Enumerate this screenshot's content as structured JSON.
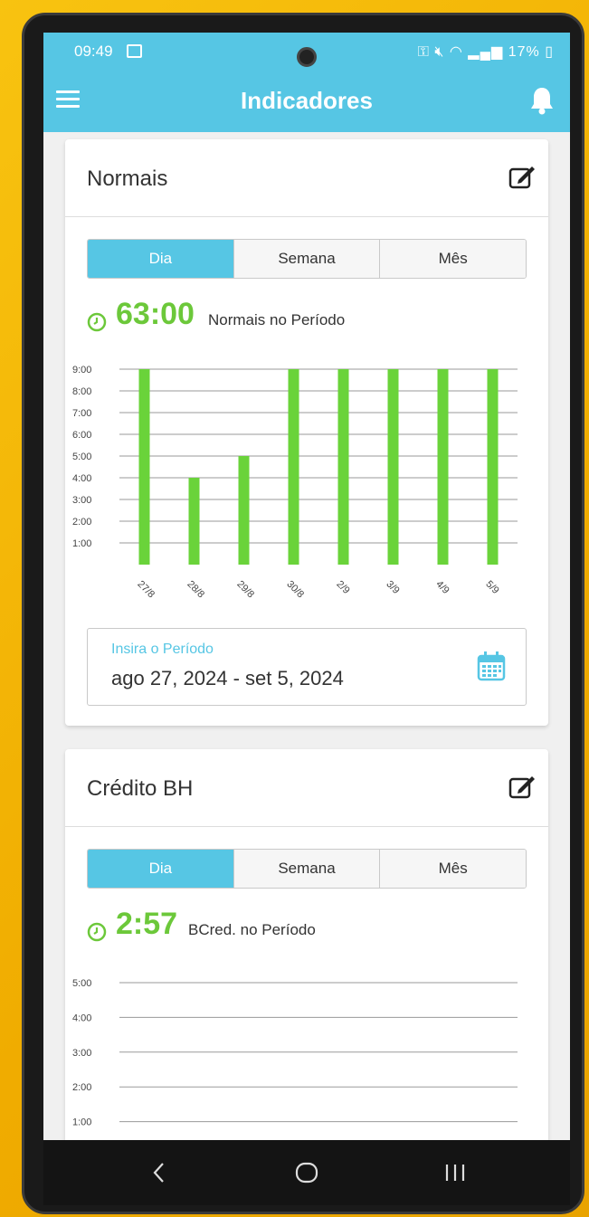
{
  "status": {
    "time": "09:49",
    "battery": "17%"
  },
  "appbar": {
    "title": "Indicadores"
  },
  "cards": [
    {
      "title": "Normais",
      "tabs": [
        "Dia",
        "Semana",
        "Mês"
      ],
      "active_tab": "Dia",
      "total_value": "63:00",
      "total_label": "Normais no Período",
      "date_label": "Insira o Período",
      "date_value": "ago 27, 2024 - set 5, 2024"
    },
    {
      "title": "Crédito BH",
      "tabs": [
        "Dia",
        "Semana",
        "Mês"
      ],
      "active_tab": "Dia",
      "total_value": "2:57",
      "total_label": "BCred. no Período"
    }
  ],
  "colors": {
    "accent": "#56c6e4",
    "bar": "#6ad33a",
    "total": "#6cc83a"
  },
  "chart_data": [
    {
      "type": "bar",
      "categories": [
        "27/8",
        "28/8",
        "29/8",
        "30/8",
        "2/9",
        "3/9",
        "4/9",
        "5/9"
      ],
      "values": [
        9,
        4,
        5,
        9,
        9,
        9,
        9,
        9
      ],
      "y_ticks": [
        "1:00",
        "2:00",
        "3:00",
        "4:00",
        "5:00",
        "6:00",
        "7:00",
        "8:00",
        "9:00"
      ],
      "ylim": [
        0,
        9
      ],
      "grid": true
    },
    {
      "type": "bar",
      "categories": [],
      "values": [],
      "y_ticks": [
        "1:00",
        "2:00",
        "3:00",
        "4:00",
        "5:00"
      ],
      "ylim": [
        0,
        5
      ],
      "grid": true
    }
  ]
}
